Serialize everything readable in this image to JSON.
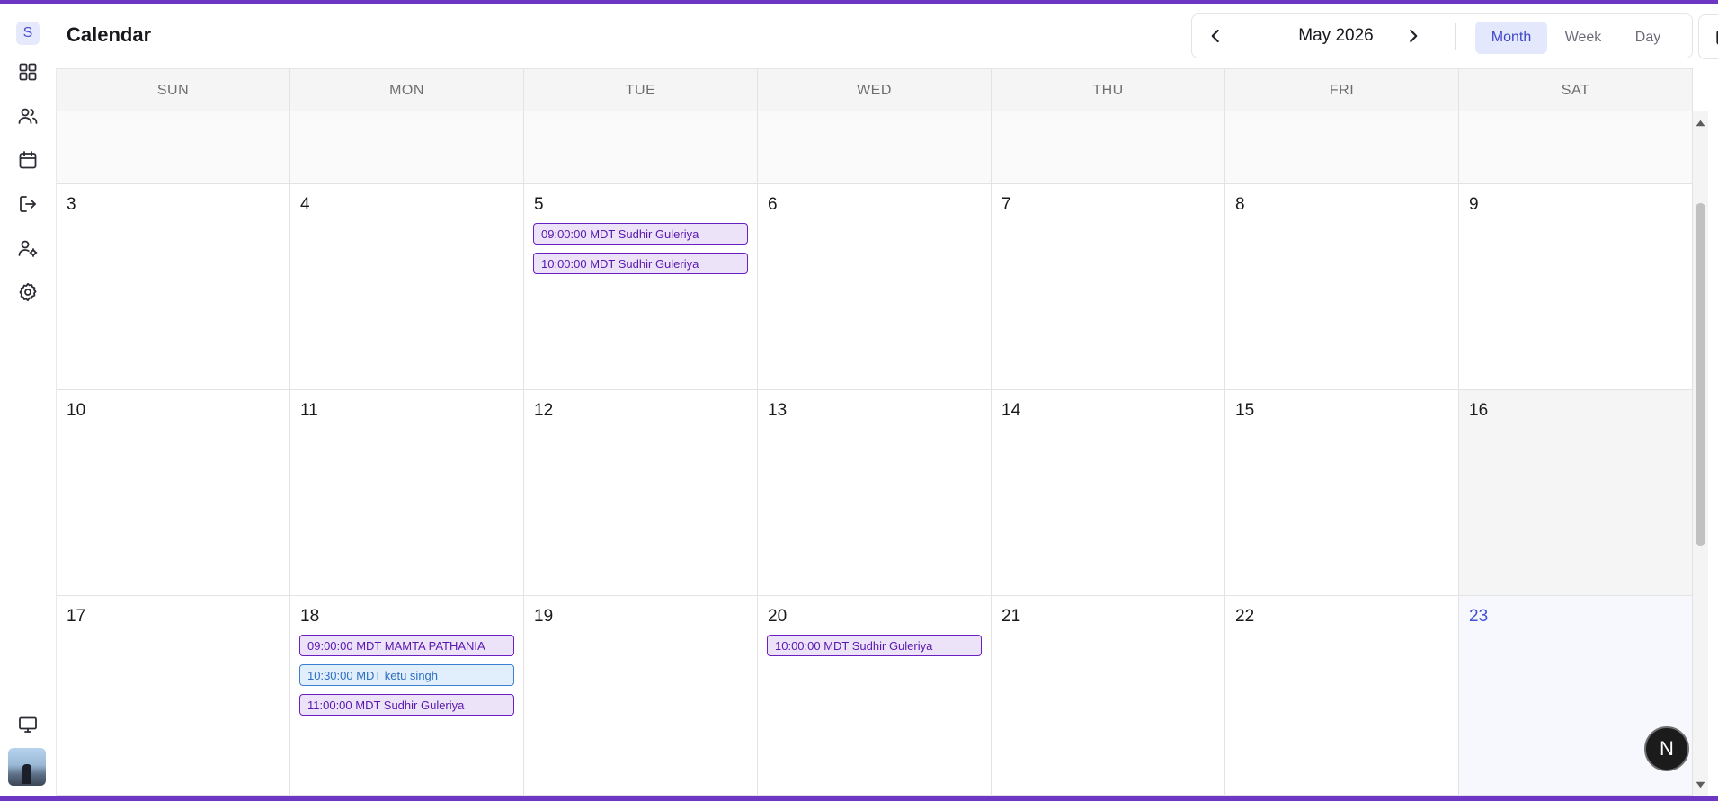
{
  "sidebar": {
    "brand_letter": "S",
    "items": [
      {
        "icon": "dashboard-icon"
      },
      {
        "icon": "users-icon"
      },
      {
        "icon": "calendar-icon"
      },
      {
        "icon": "logout-icon"
      },
      {
        "icon": "user-settings-icon"
      },
      {
        "icon": "gear-icon"
      }
    ],
    "bottom_icon": "monitor-icon"
  },
  "header": {
    "title": "Calendar",
    "month_label": "May 2026",
    "views": [
      "Month",
      "Week",
      "Day"
    ],
    "active_view": "Month"
  },
  "calendar": {
    "weekdays": [
      "SUN",
      "MON",
      "TUE",
      "WED",
      "THU",
      "FRI",
      "SAT"
    ],
    "weeks": [
      {
        "days": [
          "",
          "",
          "",
          "",
          "",
          "",
          ""
        ]
      },
      {
        "days": [
          "3",
          "4",
          "5",
          "6",
          "7",
          "8",
          "9"
        ]
      },
      {
        "days": [
          "10",
          "11",
          "12",
          "13",
          "14",
          "15",
          "16"
        ]
      },
      {
        "days": [
          "17",
          "18",
          "19",
          "20",
          "21",
          "22",
          "23"
        ]
      }
    ],
    "today": "23",
    "events": [
      {
        "week": 1,
        "day": 2,
        "label": "09:00:00 MDT Sudhir Guleriya",
        "color": "purple"
      },
      {
        "week": 1,
        "day": 2,
        "label": "10:00:00 MDT Sudhir Guleriya",
        "color": "purple"
      },
      {
        "week": 3,
        "day": 1,
        "label": "09:00:00 MDT MAMTA PATHANIA",
        "color": "purple"
      },
      {
        "week": 3,
        "day": 1,
        "label": "10:30:00 MDT ketu singh",
        "color": "blue"
      },
      {
        "week": 3,
        "day": 1,
        "label": "11:00:00 MDT Sudhir Guleriya",
        "color": "purple"
      },
      {
        "week": 3,
        "day": 3,
        "label": "10:00:00 MDT Sudhir Guleriya",
        "color": "purple"
      }
    ]
  },
  "fab_label": "N",
  "colors": {
    "accent": "#4046c8",
    "event_purple": "#6a1fc2",
    "event_blue": "#3a7fd0",
    "frame_border": "#6d36c4"
  }
}
